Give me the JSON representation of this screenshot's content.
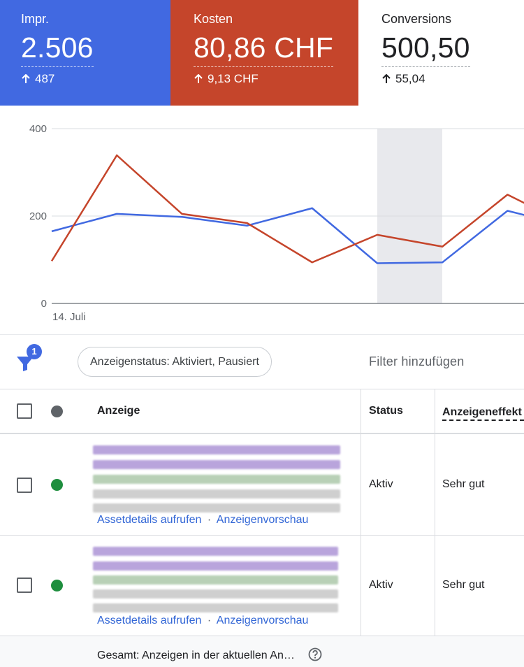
{
  "metrics": [
    {
      "label": "Impr.",
      "value": "2.506",
      "delta": "487",
      "color": "#4169e1"
    },
    {
      "label": "Kosten",
      "value": "80,86 CHF",
      "delta": "9,13 CHF",
      "color": "#c5452b"
    },
    {
      "label": "Conversions",
      "value": "500,50",
      "delta": "55,04",
      "color": "#ffffff"
    }
  ],
  "chart_data": {
    "type": "line",
    "x": [
      0,
      1,
      2,
      3,
      4,
      5,
      6,
      7,
      8,
      9
    ],
    "x_labels": [
      "14. Juli"
    ],
    "ylim": [
      0,
      400
    ],
    "yticks": [
      "0",
      "200",
      "400"
    ],
    "grid": true,
    "highlight_x_range": [
      6,
      7
    ],
    "series": [
      {
        "color": "#4169e1",
        "values": [
          165,
          205,
          198,
          178,
          218,
          92,
          94,
          212,
          175
        ]
      },
      {
        "color": "#c5452b",
        "values": [
          97,
          339,
          205,
          184,
          94,
          157,
          130,
          249,
          175
        ]
      }
    ]
  },
  "filter": {
    "count": "1",
    "chip_label": "Anzeigenstatus: Aktiviert, Pausiert",
    "add_label": "Filter hinzufügen"
  },
  "table": {
    "headers": {
      "ad": "Anzeige",
      "status": "Status",
      "effect": "Anzeigeneffekt"
    },
    "rows": [
      {
        "status": "Aktiv",
        "effect": "Sehr gut",
        "link1": "Assetdetails aufrufen",
        "sep": "·",
        "link2": "Anzeigenvorschau"
      },
      {
        "status": "Aktiv",
        "effect": "Sehr gut",
        "link1": "Assetdetails aufrufen",
        "sep": "·",
        "link2": "Anzeigenvorschau"
      }
    ],
    "total": "Gesamt: Anzeigen in der aktuellen An…"
  },
  "colors": {
    "status_active": "#1e8e3e",
    "status_header": "#5f6368",
    "link": "#3367d6"
  }
}
